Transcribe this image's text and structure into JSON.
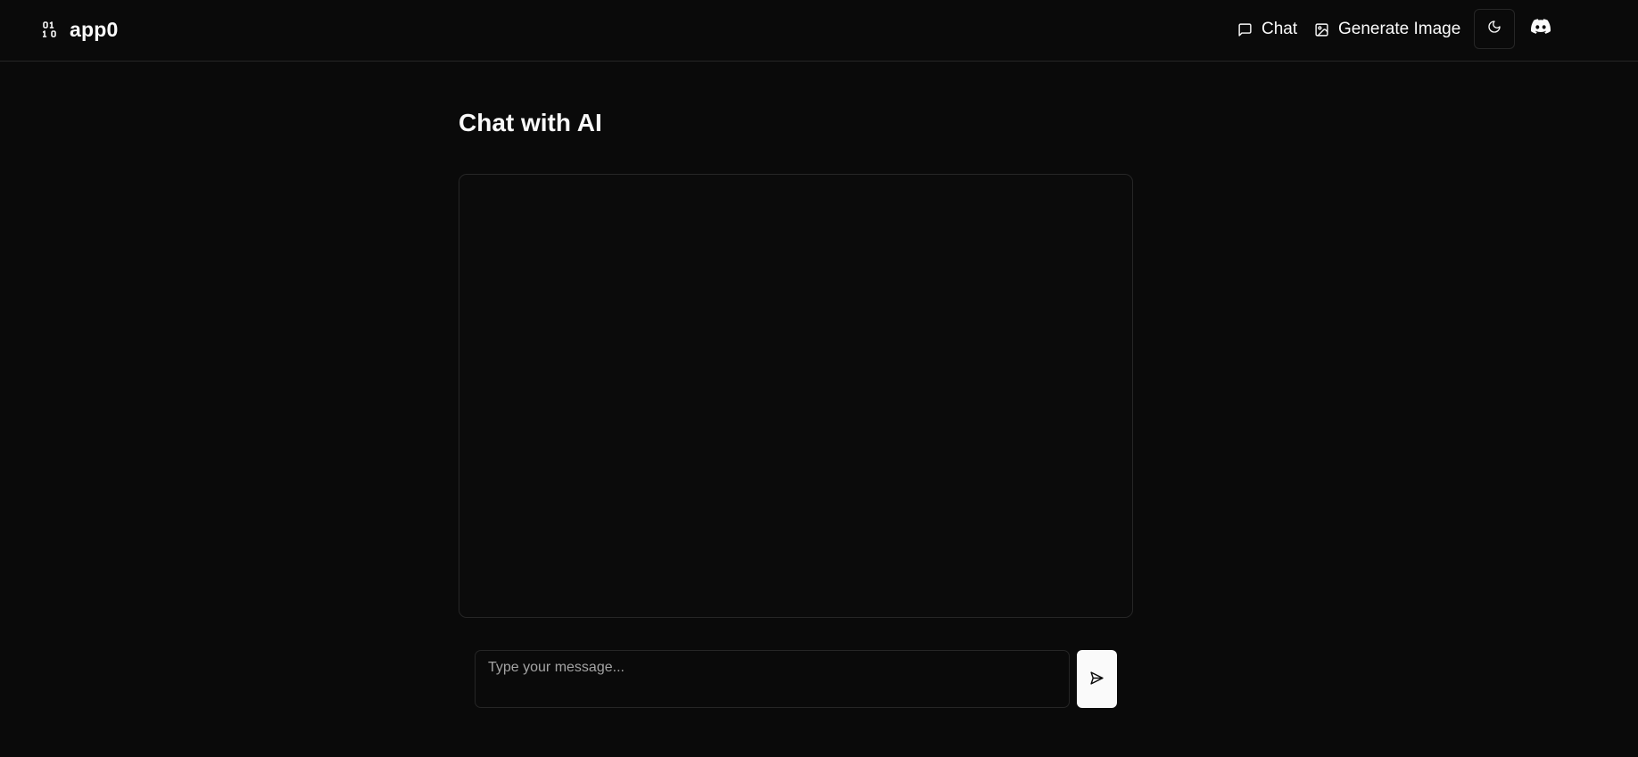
{
  "header": {
    "brand": {
      "name": "app0",
      "icon": "binary-icon"
    },
    "nav": [
      {
        "label": "Chat",
        "icon": "message-square-icon"
      },
      {
        "label": "Generate Image",
        "icon": "image-icon"
      }
    ],
    "theme_toggle": {
      "icon": "moon-icon"
    },
    "discord": {
      "icon": "discord-icon"
    }
  },
  "main": {
    "title": "Chat with AI",
    "input": {
      "value": "",
      "placeholder": "Type your message..."
    },
    "send_button": {
      "icon": "send-icon"
    }
  },
  "colors": {
    "background": "#0a0a0a",
    "border": "#262626",
    "text": "#fafafa",
    "muted": "#a3a3a3",
    "button_bg": "#fafafa"
  }
}
